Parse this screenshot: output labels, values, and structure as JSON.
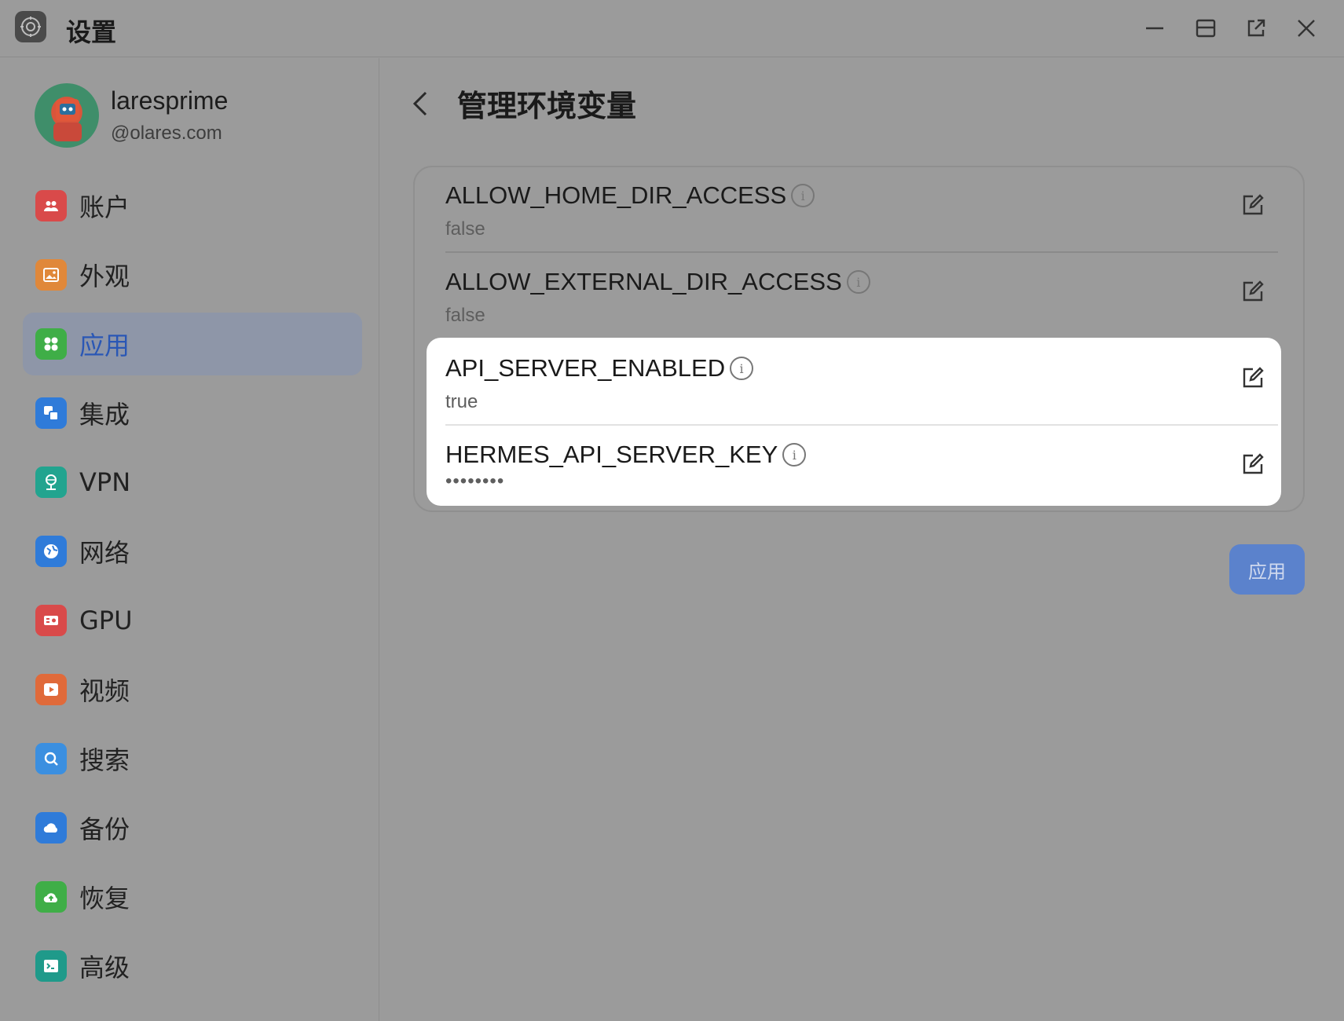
{
  "window": {
    "title": "设置",
    "controls": [
      "minimize",
      "restore",
      "popout",
      "close"
    ]
  },
  "user": {
    "name": "laresprime",
    "domain": "@olares.com"
  },
  "sidebar": {
    "items": [
      {
        "label": "账户",
        "icon": "account-icon",
        "color": "#d94a4a"
      },
      {
        "label": "外观",
        "icon": "appearance-icon",
        "color": "#e0883a"
      },
      {
        "label": "应用",
        "icon": "apps-icon",
        "color": "#3fae47",
        "active": true
      },
      {
        "label": "集成",
        "icon": "integration-icon",
        "color": "#2f7bd9"
      },
      {
        "label": "VPN",
        "icon": "vpn-icon",
        "color": "#22a48f"
      },
      {
        "label": "网络",
        "icon": "network-icon",
        "color": "#2f7bd9"
      },
      {
        "label": "GPU",
        "icon": "gpu-icon",
        "color": "#d94a4a"
      },
      {
        "label": "视频",
        "icon": "video-icon",
        "color": "#e06a3a"
      },
      {
        "label": "搜索",
        "icon": "search-icon",
        "color": "#3b8fe0"
      },
      {
        "label": "备份",
        "icon": "backup-icon",
        "color": "#2f7bd9"
      },
      {
        "label": "恢复",
        "icon": "restore-icon",
        "color": "#3fae47"
      },
      {
        "label": "高级",
        "icon": "advanced-icon",
        "color": "#1f9a8a"
      }
    ]
  },
  "main": {
    "title": "管理环境变量",
    "env_vars": [
      {
        "name": "ALLOW_HOME_DIR_ACCESS",
        "value": "false"
      },
      {
        "name": "ALLOW_EXTERNAL_DIR_ACCESS",
        "value": "false"
      },
      {
        "name": "API_SERVER_ENABLED",
        "value": "true"
      },
      {
        "name": "HERMES_API_SERVER_KEY",
        "value": "••••••••"
      }
    ],
    "apply_label": "应用"
  },
  "colors": {
    "accent": "#5b82cc",
    "active_label": "#2a57b5"
  }
}
